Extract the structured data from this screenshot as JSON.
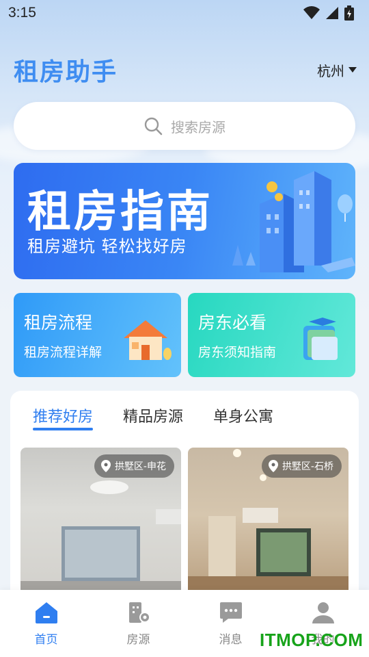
{
  "status_bar": {
    "time": "3:15"
  },
  "header": {
    "title": "租房助手",
    "city": "杭州"
  },
  "search": {
    "placeholder": "搜索房源"
  },
  "banner": {
    "title": "租房指南",
    "subtitle": "租房避坑 轻松找好房"
  },
  "cards": [
    {
      "title": "租房流程",
      "subtitle": "租房流程详解"
    },
    {
      "title": "房东必看",
      "subtitle": "房东须知指南"
    }
  ],
  "listing_tabs": [
    {
      "label": "推荐好房",
      "active": true
    },
    {
      "label": "精品房源",
      "active": false
    },
    {
      "label": "单身公寓",
      "active": false
    }
  ],
  "listings": [
    {
      "location": "拱墅区-申花"
    },
    {
      "location": "拱墅区-石桥"
    }
  ],
  "tabbar": [
    {
      "label": "首页",
      "icon": "home-icon",
      "active": true
    },
    {
      "label": "房源",
      "icon": "building-icon",
      "active": false
    },
    {
      "label": "消息",
      "icon": "message-icon",
      "active": false
    },
    {
      "label": "我的",
      "icon": "user-icon",
      "active": false
    }
  ],
  "watermark": "ITMOP.COM",
  "colors": {
    "accent": "#2f7ef0",
    "title": "#3f8df1",
    "card_blue": "#2f9af8",
    "card_teal": "#27d8c0"
  }
}
